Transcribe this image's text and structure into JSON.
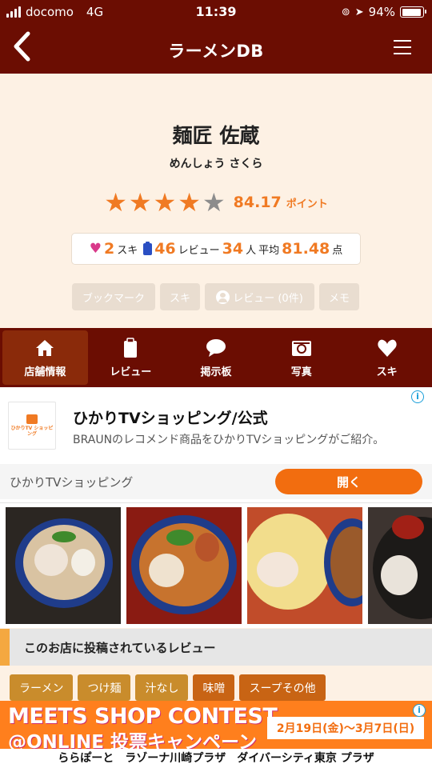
{
  "status_bar": {
    "carrier": "docomo",
    "network": "4G",
    "time": "11:39",
    "battery": "94%",
    "battery_level": 0.94
  },
  "navbar": {
    "back_icon": "chevron-left-icon",
    "title": "ラーメンDB",
    "menu_icon": "hamburger-menu-icon"
  },
  "shop": {
    "name": "麺匠 佐蔵",
    "kana": "めんしょう さくら",
    "rating_stars": 4,
    "rating_max": 5,
    "score": "84.17",
    "score_unit": "ポイント",
    "likes_count": "2",
    "likes_label": "スキ",
    "review_count": "46",
    "review_label": "レビュー",
    "reviewer_count": "34",
    "reviewer_unit": "人",
    "avg_label": "平均",
    "avg_score": "81.48",
    "avg_unit": "点"
  },
  "actions": {
    "bookmark": "ブックマーク",
    "like": "スキ",
    "review": "レビュー (0件)",
    "memo": "メモ"
  },
  "tabs": [
    {
      "label": "店舗情報",
      "icon": "home-icon",
      "active": true
    },
    {
      "label": "レビュー",
      "icon": "clipboard-icon",
      "active": false
    },
    {
      "label": "掲示板",
      "icon": "chat-bubble-icon",
      "active": false
    },
    {
      "label": "写真",
      "icon": "camera-icon",
      "active": false
    },
    {
      "label": "スキ",
      "icon": "heart-icon",
      "active": false
    }
  ],
  "ad": {
    "logo_text": "ひかりTV ショッピング",
    "headline": "ひかりTVショッピング/公式",
    "description": "BRAUNのレコメンド商品をひかりTVショッピングがご紹介。",
    "advertiser": "ひかりTVショッピング",
    "cta": "開く"
  },
  "reviews": {
    "heading": "このお店に投稿されているレビュー",
    "filters": [
      "ラーメン",
      "つけ麺",
      "汁なし",
      "味噌",
      "スープその他"
    ]
  },
  "banner": {
    "line1": "MEETS SHOP CONTEST",
    "line2": "@ONLINE 投票キャンペーン",
    "dates": "2月19日(金)～3月7日(日)",
    "malls": "ららぽーと　ラゾーナ川崎プラザ　ダイバーシティ東京 プラザ"
  },
  "colors": {
    "brand": "#6b0d02",
    "accent": "#f07a23",
    "background": "#fdf1e4",
    "cta": "#f26d0f"
  }
}
